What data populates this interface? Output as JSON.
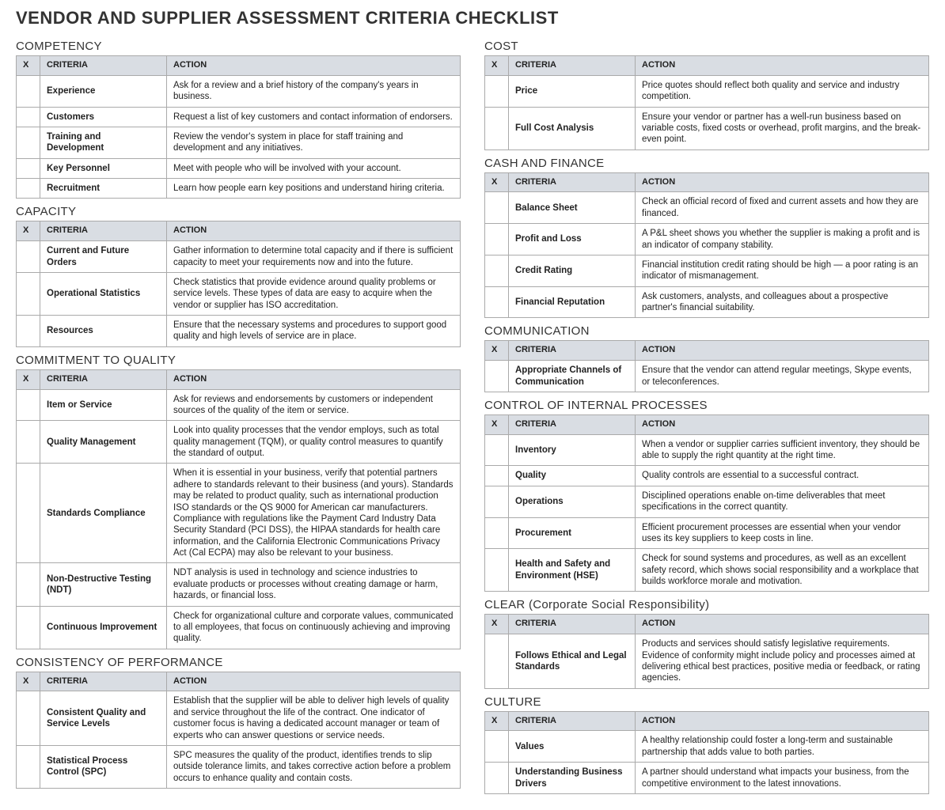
{
  "title": "VENDOR AND SUPPLIER ASSESSMENT CRITERIA CHECKLIST",
  "headers": {
    "x": "X",
    "criteria": "CRITERIA",
    "action": "ACTION"
  },
  "left": [
    {
      "title": "COMPETENCY",
      "rows": [
        {
          "criteria": "Experience",
          "action": "Ask for a review and a brief history of the company's years in business."
        },
        {
          "criteria": "Customers",
          "action": "Request a list of key customers and contact information of endorsers."
        },
        {
          "criteria": "Training and Development",
          "action": "Review the vendor's system in place for staff training and development and any initiatives."
        },
        {
          "criteria": "Key Personnel",
          "action": "Meet with people who will be involved with your account."
        },
        {
          "criteria": "Recruitment",
          "action": "Learn how people earn key positions and understand hiring criteria."
        }
      ]
    },
    {
      "title": "CAPACITY",
      "rows": [
        {
          "criteria": "Current and Future Orders",
          "action": "Gather information to determine total capacity and if there is sufficient capacity to meet your requirements now and into the future."
        },
        {
          "criteria": "Operational Statistics",
          "action": "Check statistics that provide evidence around quality problems or service levels. These types of data are easy to acquire when the vendor or supplier has ISO accreditation."
        },
        {
          "criteria": "Resources",
          "action": "Ensure that the necessary systems and procedures to support good quality and high levels of service are in place."
        }
      ]
    },
    {
      "title": "COMMITMENT TO QUALITY",
      "rows": [
        {
          "criteria": "Item or Service",
          "action": "Ask for reviews and endorsements by customers or independent sources of the quality of the item or service."
        },
        {
          "criteria": "Quality Management",
          "action": "Look into quality processes that the vendor employs, such as total quality management (TQM), or quality control measures to quantify the standard of output."
        },
        {
          "criteria": "Standards Compliance",
          "action": "When it is essential in your business, verify that potential partners adhere to standards relevant to their business (and yours). Standards may be related to product quality, such as international production ISO standards or the QS 9000 for American car manufacturers. Compliance with regulations like the Payment Card Industry Data Security Standard (PCI DSS), the HIPAA standards for health care information, and the California Electronic Communications Privacy Act (Cal ECPA) may also be relevant to your business."
        },
        {
          "criteria": "Non-Destructive Testing (NDT)",
          "action": "NDT analysis is used in technology and science industries to evaluate products or processes without creating damage or harm, hazards, or financial loss."
        },
        {
          "criteria": "Continuous Improvement",
          "action": "Check for organizational culture and corporate values, communicated to all employees, that focus on continuously achieving and improving quality."
        }
      ]
    },
    {
      "title": "CONSISTENCY OF PERFORMANCE",
      "rows": [
        {
          "criteria": "Consistent Quality and Service Levels",
          "action": "Establish that the supplier will be able to deliver high levels of quality and service throughout the life of the contract. One indicator of customer focus is having a dedicated account manager or team of experts who can answer questions or service needs."
        },
        {
          "criteria": "Statistical Process Control (SPC)",
          "action": "SPC measures the quality of the product, identifies trends to slip outside tolerance limits, and takes corrective action before a problem occurs to enhance quality and contain costs."
        }
      ]
    }
  ],
  "right": [
    {
      "title": "COST",
      "rows": [
        {
          "criteria": "Price",
          "action": "Price quotes should reflect both quality and service and industry competition."
        },
        {
          "criteria": "Full Cost Analysis",
          "action": "Ensure your vendor or partner has a well-run business based on variable costs, fixed costs or overhead, profit margins, and the break-even point."
        }
      ]
    },
    {
      "title": "CASH AND FINANCE",
      "rows": [
        {
          "criteria": "Balance Sheet",
          "action": "Check an official record of fixed and current assets and how they are financed."
        },
        {
          "criteria": "Profit and Loss",
          "action": "A P&L sheet shows you whether the supplier is making a profit and is an indicator of company stability."
        },
        {
          "criteria": "Credit Rating",
          "action": "Financial institution credit rating should be high — a poor rating is an indicator of mismanagement."
        },
        {
          "criteria": "Financial Reputation",
          "action": "Ask customers, analysts, and colleagues about a prospective partner's financial suitability."
        }
      ]
    },
    {
      "title": "COMMUNICATION",
      "rows": [
        {
          "criteria": "Appropriate Channels of Communication",
          "action": "Ensure that the vendor can attend regular meetings, Skype events, or teleconferences."
        }
      ]
    },
    {
      "title": "CONTROL OF INTERNAL PROCESSES",
      "rows": [
        {
          "criteria": "Inventory",
          "action": "When a vendor or supplier carries sufficient inventory, they should be able to supply the right quantity at the right time."
        },
        {
          "criteria": "Quality",
          "action": "Quality controls are essential to a successful contract."
        },
        {
          "criteria": "Operations",
          "action": "Disciplined operations enable on-time deliverables that meet specifications in the correct quantity."
        },
        {
          "criteria": "Procurement",
          "action": "Efficient procurement processes are essential when your vendor uses its key suppliers to keep costs in line."
        },
        {
          "criteria": "Health and Safety and Environment (HSE)",
          "action": "Check for sound systems and procedures, as well as an excellent safety record, which shows social responsibility and a workplace that builds workforce morale and motivation."
        }
      ]
    },
    {
      "title": "CLEAR (Corporate Social Responsibility)",
      "rows": [
        {
          "criteria": "Follows Ethical and Legal Standards",
          "action": "Products and services should satisfy legislative requirements. Evidence of conformity might include policy and processes aimed at delivering ethical best practices, positive media or feedback, or rating agencies."
        }
      ]
    },
    {
      "title": "CULTURE",
      "rows": [
        {
          "criteria": "Values",
          "action": "A healthy relationship could foster a long-term and sustainable partnership that adds value to both parties."
        },
        {
          "criteria": "Understanding Business Drivers",
          "action": "A partner should understand what impacts your business, from the competitive environment to the latest innovations."
        }
      ]
    }
  ]
}
